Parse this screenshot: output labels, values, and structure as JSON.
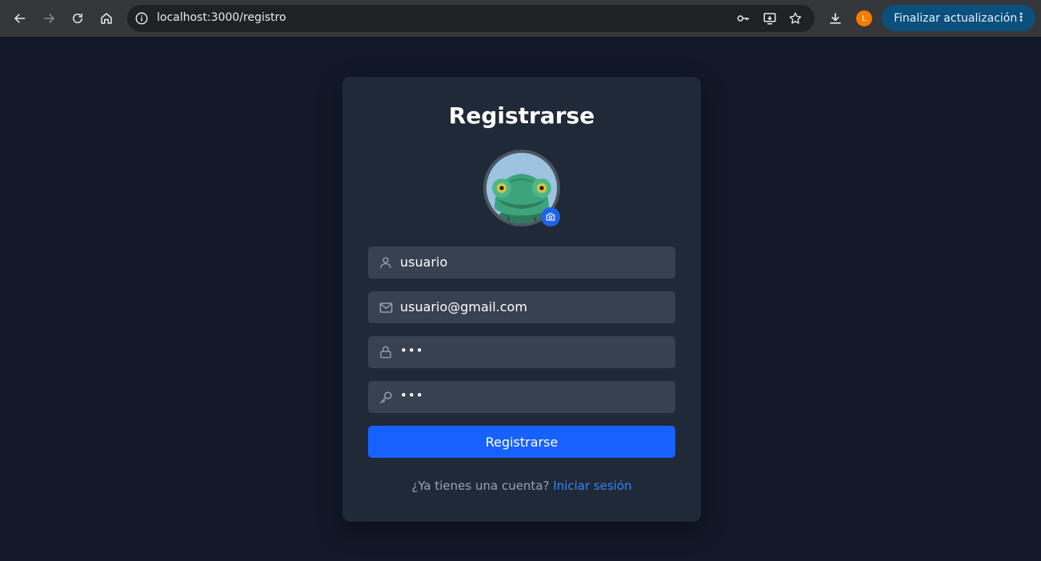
{
  "browser": {
    "url": "localhost:3000/registro",
    "profile_initial": "L",
    "update_label": "Finalizar actualización",
    "menu_glyph": "⋮"
  },
  "form": {
    "title": "Registrarse",
    "avatar_alt": "chameleon avatar",
    "fields": {
      "username": {
        "value": "usuario",
        "icon": "user-icon"
      },
      "email": {
        "value": "usuario@gmail.com",
        "icon": "mail-icon"
      },
      "password": {
        "value": "•••",
        "icon": "lock-icon"
      },
      "confirm_password": {
        "value": "•••",
        "icon": "key-icon"
      }
    },
    "submit_label": "Registrarse",
    "footer_prompt": "¿Ya tienes una cuenta?",
    "footer_link": "Iniciar sesión"
  },
  "colors": {
    "page_bg": "#111827",
    "card_bg": "#1f2937",
    "field_bg": "#374151",
    "primary": "#1762fe",
    "link": "#3b82f6",
    "muted_text": "#9ca3af"
  }
}
